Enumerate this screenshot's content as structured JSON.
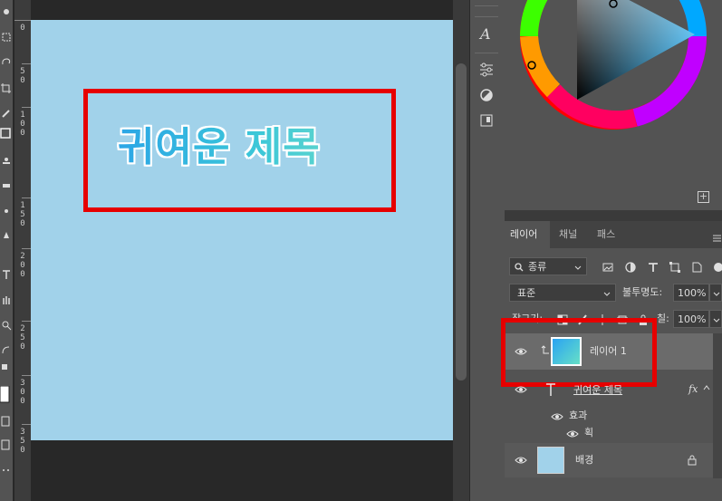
{
  "ruler": {
    "labels": [
      "0",
      "5\n0",
      "1\n0\n0",
      "1\n5\n0",
      "2\n0\n0",
      "2\n5\n0",
      "3\n0\n0",
      "3\n5\n0"
    ]
  },
  "canvas": {
    "title_text": "귀여운 제목",
    "background": "#a1d2ea",
    "highlight_color": "#e60000"
  },
  "color_panel": {
    "add_swatch": "+"
  },
  "layers_panel": {
    "tabs": [
      "레이어",
      "채널",
      "패스"
    ],
    "active_tab": "레이어",
    "filter": {
      "label": "종류"
    },
    "blend_mode": "표준",
    "opacity_label": "불투명도:",
    "opacity_value": "100%",
    "lock_label": "잠그기:",
    "fill_label": "칠:",
    "fill_value": "100%",
    "layers": [
      {
        "name": "레이어 1",
        "type": "pixel",
        "selected": true
      },
      {
        "name": "귀여운 제목",
        "type": "text",
        "fx": "fx",
        "effects_label": "효과",
        "effect": "획"
      },
      {
        "name": "배경",
        "type": "background",
        "locked": true
      }
    ]
  }
}
